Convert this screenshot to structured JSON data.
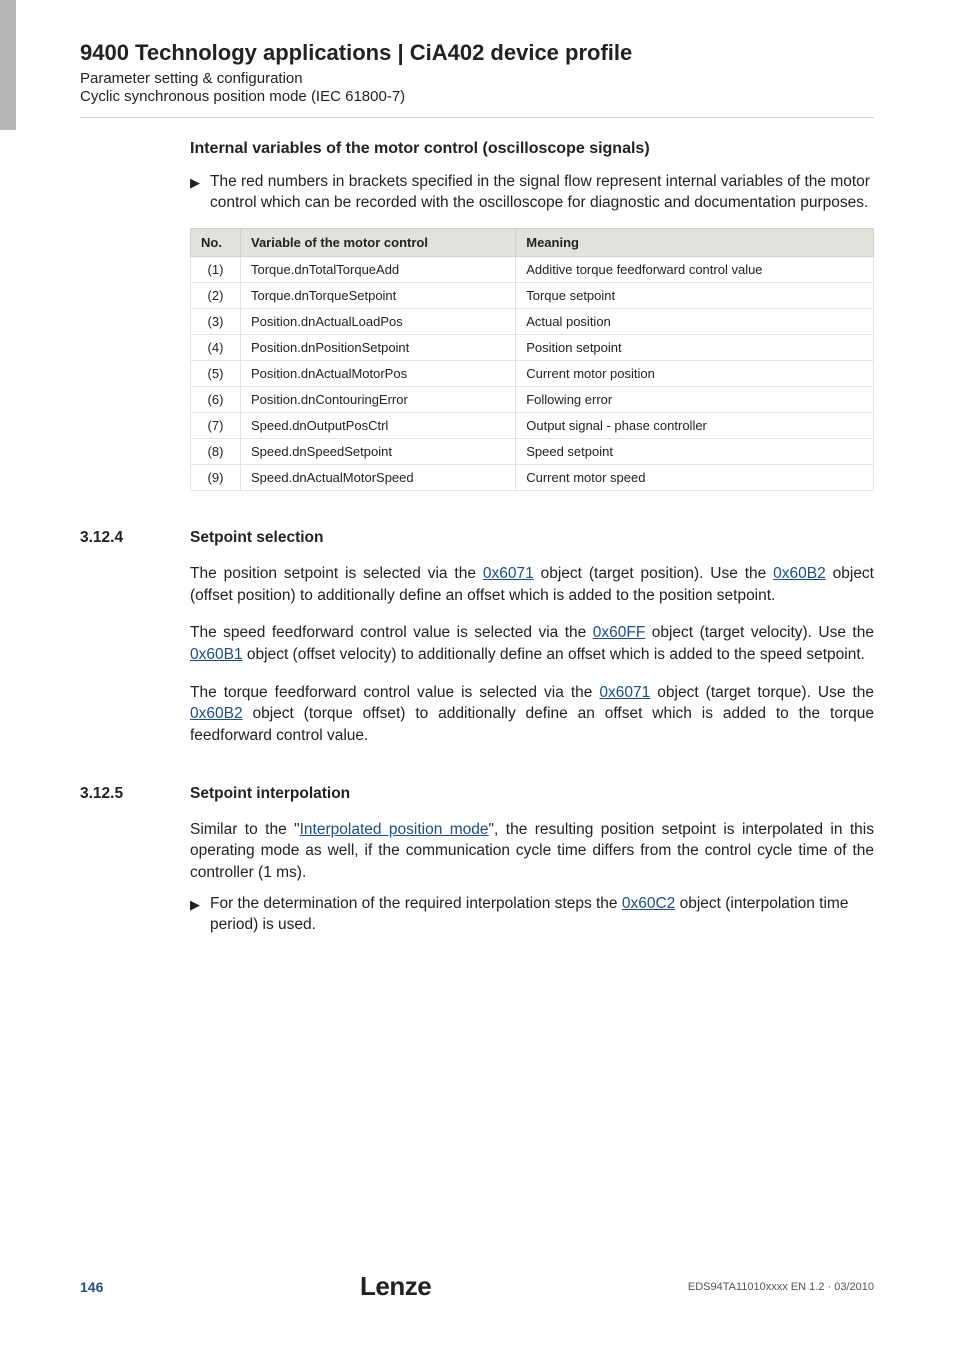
{
  "header": {
    "title": "9400 Technology applications | CiA402 device profile",
    "sub1": "Parameter setting & configuration",
    "sub2": "Cyclic synchronous position mode (IEC 61800-7)"
  },
  "section_vars": {
    "heading": "Internal variables of the motor control (oscilloscope signals)",
    "bullet": "The red numbers in brackets specified in the signal flow represent internal variables of the motor control which can be recorded with the oscilloscope for diagnostic and documentation purposes.",
    "table": {
      "headers": {
        "no": "No.",
        "var": "Variable of the motor control",
        "meaning": "Meaning"
      },
      "rows": [
        {
          "no": "(1)",
          "var": "Torque.dnTotalTorqueAdd",
          "meaning": "Additive torque feedforward control value"
        },
        {
          "no": "(2)",
          "var": "Torque.dnTorqueSetpoint",
          "meaning": "Torque setpoint"
        },
        {
          "no": "(3)",
          "var": "Position.dnActualLoadPos",
          "meaning": "Actual position"
        },
        {
          "no": "(4)",
          "var": "Position.dnPositionSetpoint",
          "meaning": "Position setpoint"
        },
        {
          "no": "(5)",
          "var": "Position.dnActualMotorPos",
          "meaning": "Current motor position"
        },
        {
          "no": "(6)",
          "var": "Position.dnContouringError",
          "meaning": "Following error"
        },
        {
          "no": "(7)",
          "var": "Speed.dnOutputPosCtrl",
          "meaning": "Output signal - phase controller"
        },
        {
          "no": "(8)",
          "var": "Speed.dnSpeedSetpoint",
          "meaning": "Speed setpoint"
        },
        {
          "no": "(9)",
          "var": "Speed.dnActualMotorSpeed",
          "meaning": "Current motor speed"
        }
      ]
    }
  },
  "sections": {
    "s3124": {
      "num": "3.12.4",
      "title": "Setpoint selection",
      "p1a": "The position setpoint is selected via the ",
      "p1_link1": "0x6071",
      "p1b": " object (target position). Use the ",
      "p1_link2": "0x60B2",
      "p1c": " object (offset position) to additionally define an offset which is added to the position setpoint.",
      "p2a": "The speed feedforward control value is selected via the ",
      "p2_link1": "0x60FF",
      "p2b": " object (target velocity). Use the ",
      "p2_link2": "0x60B1",
      "p2c": " object (offset velocity) to additionally define an offset which is added to the speed setpoint.",
      "p3a": "The torque feedforward control value is selected via the ",
      "p3_link1": "0x6071",
      "p3b": " object (target torque). Use the ",
      "p3_link2": "0x60B2",
      "p3c": " object (torque offset) to additionally define an offset which is added to the torque feedforward control value."
    },
    "s3125": {
      "num": "3.12.5",
      "title": "Setpoint interpolation",
      "p1a": "Similar to the \"",
      "p1_link1": "Interpolated position mode",
      "p1b": "\", the resulting position setpoint is interpolated in this operating mode as well, if the communication cycle time differs from the control cycle time of the controller (1 ms).",
      "bullet_a": "For the determination of the required interpolation steps the ",
      "bullet_link": "0x60C2",
      "bullet_b": " object (interpolation time period) is used."
    }
  },
  "footer": {
    "page": "146",
    "brand": "Lenze",
    "docref": "EDS94TA11010xxxx EN 1.2 · 03/2010"
  }
}
